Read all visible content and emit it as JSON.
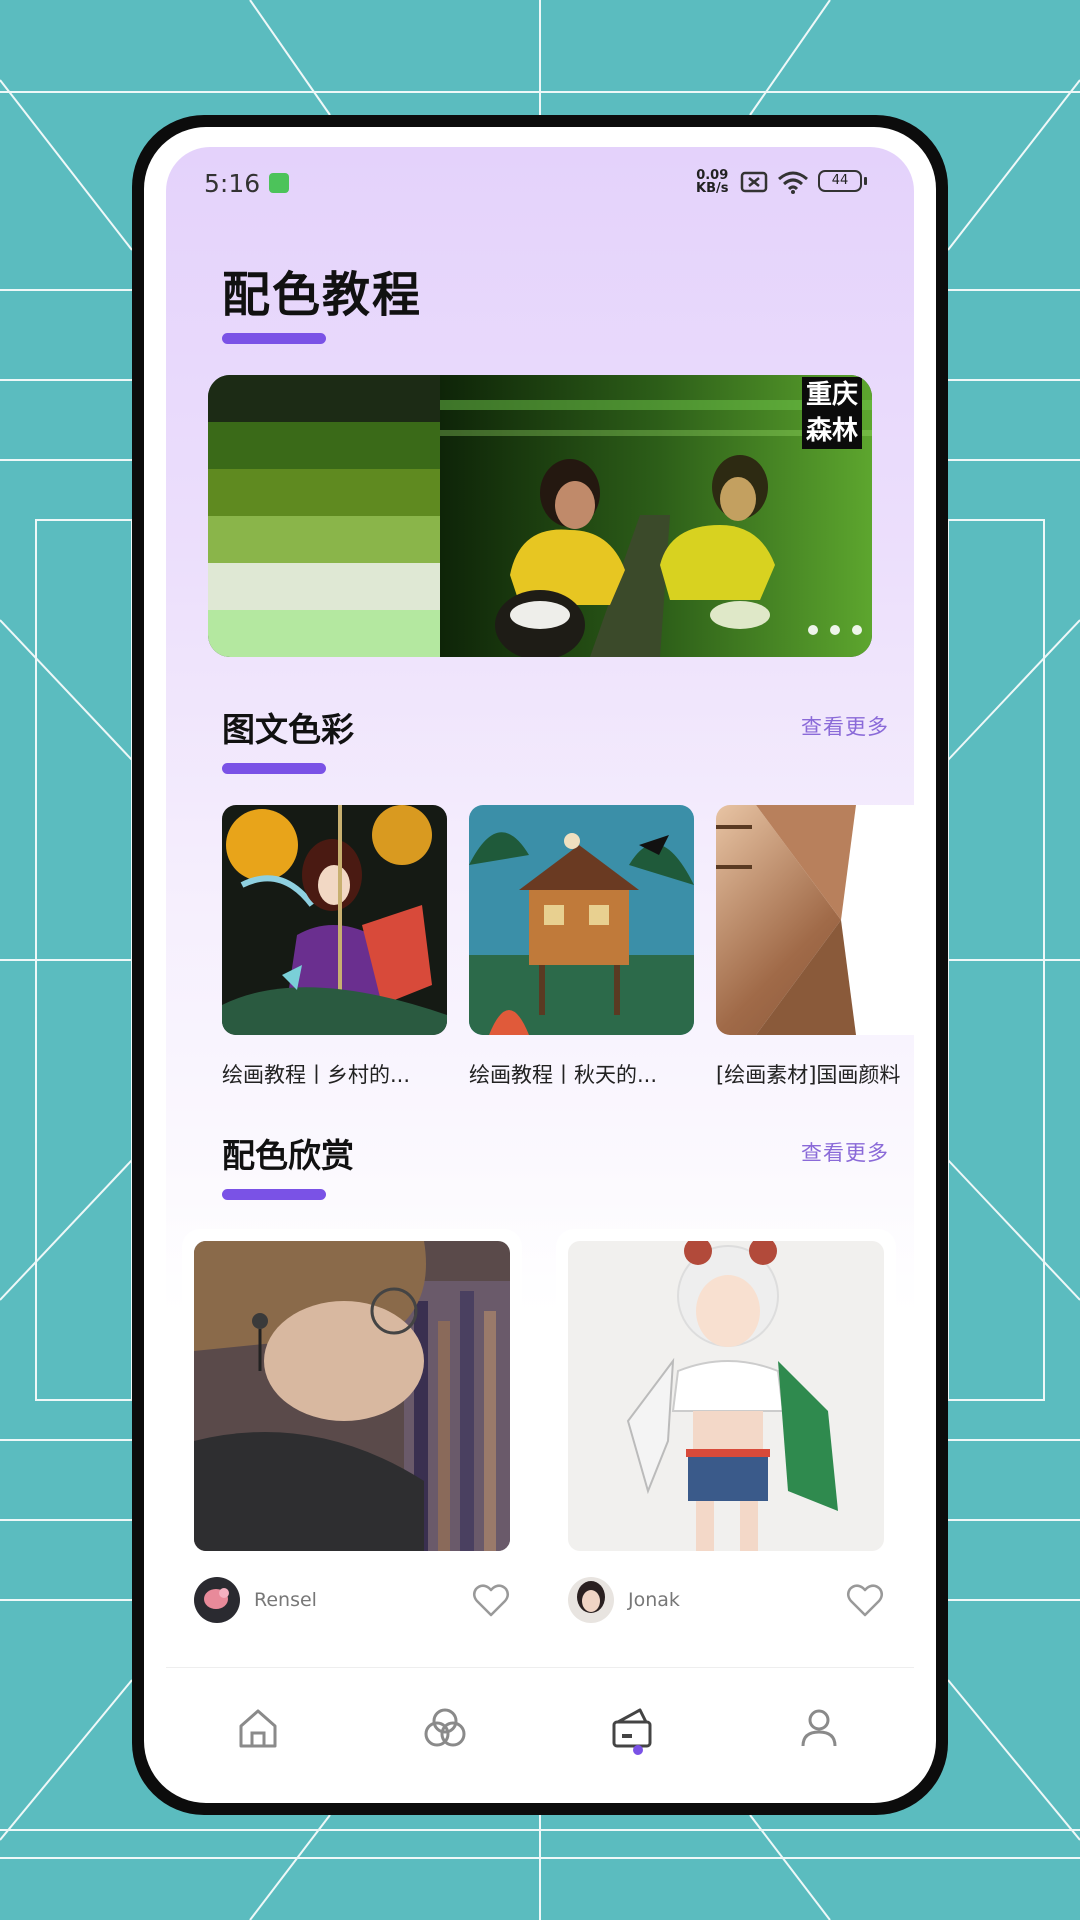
{
  "status_bar": {
    "time": "5:16",
    "net_speed_value": "0.09",
    "net_speed_unit": "KB/s",
    "battery": "44",
    "icons": [
      "app-notification-icon",
      "no-sim-icon",
      "wifi-icon",
      "battery-icon"
    ]
  },
  "page": {
    "title": "配色教程"
  },
  "banner": {
    "caption_line1": "重庆",
    "caption_line2": "森林",
    "palette": [
      "#1c2b15",
      "#3a6a18",
      "#5f8a20",
      "#8ab54a",
      "#dfe8d4",
      "#b4e8a0"
    ],
    "page_dots": 3
  },
  "section_articles": {
    "title": "图文色彩",
    "more": "查看更多",
    "items": [
      {
        "title": "绘画教程丨乡村的..."
      },
      {
        "title": "绘画教程丨秋天的..."
      },
      {
        "title": "[绘画素材]国画颜料"
      }
    ]
  },
  "section_gallery": {
    "title": "配色欣赏",
    "more": "查看更多",
    "items": [
      {
        "author": "Rensel"
      },
      {
        "author": "Jonak"
      }
    ]
  },
  "bottom_nav": {
    "items": [
      "home-icon",
      "color-circles-icon",
      "palette-box-icon",
      "user-icon"
    ],
    "active_index": 2,
    "accent": "#7a52e6"
  }
}
